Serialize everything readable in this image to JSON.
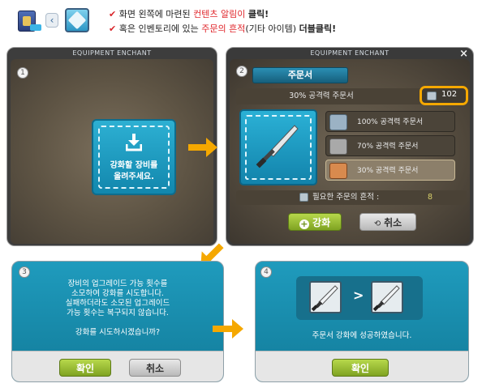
{
  "instructions": {
    "line1_pre": "화면 왼쪽에 마련된",
    "line1_highlight": "컨텐츠 알림이",
    "line1_post": "클릭!",
    "line2_pre": "혹은 인벤토리에 있는",
    "line2_highlight": "주문의 흔적",
    "line2_mid": "(기타 아이템)",
    "line2_post": "더블클릭!",
    "check_mark": "✔"
  },
  "panel1": {
    "number": "1",
    "title": "EQUIPMENT ENCHANT",
    "dropzone_text_line1": "강화할 장비를",
    "dropzone_text_line2": "올려주세요."
  },
  "panel2": {
    "number": "2",
    "title": "EQUIPMENT ENCHANT",
    "close": "×",
    "tab_label": "주문서",
    "selected_scroll": "30% 공격력 주문서",
    "count": "102",
    "scrolls": [
      {
        "label": "100% 공격력 주문서"
      },
      {
        "label": "70% 공격력 주문서"
      },
      {
        "label": "30% 공격력 주문서"
      }
    ],
    "required_label": "필요한 주문의 흔적 :",
    "required_value": "8",
    "enhance_button": "강화",
    "cancel_button": "취소"
  },
  "panel3": {
    "number": "3",
    "message_lines": [
      "장비의 업그레이드 가능 횟수를",
      "소모하여 강화를 시도합니다.",
      "실패하더라도 소모된 업그레이드",
      "가능 횟수는 복구되지 않습니다."
    ],
    "question": "강화를 시도하시겠습니까?",
    "confirm_button": "확인",
    "cancel_button": "취소"
  },
  "panel4": {
    "number": "4",
    "compare_symbol": ">",
    "message": "주문서 강화에 성공하였습니다.",
    "confirm_button": "확인"
  },
  "colors": {
    "accent_red": "#e0282d",
    "panel_teal": "#1a8ea8",
    "highlight_orange": "#f5a800"
  }
}
